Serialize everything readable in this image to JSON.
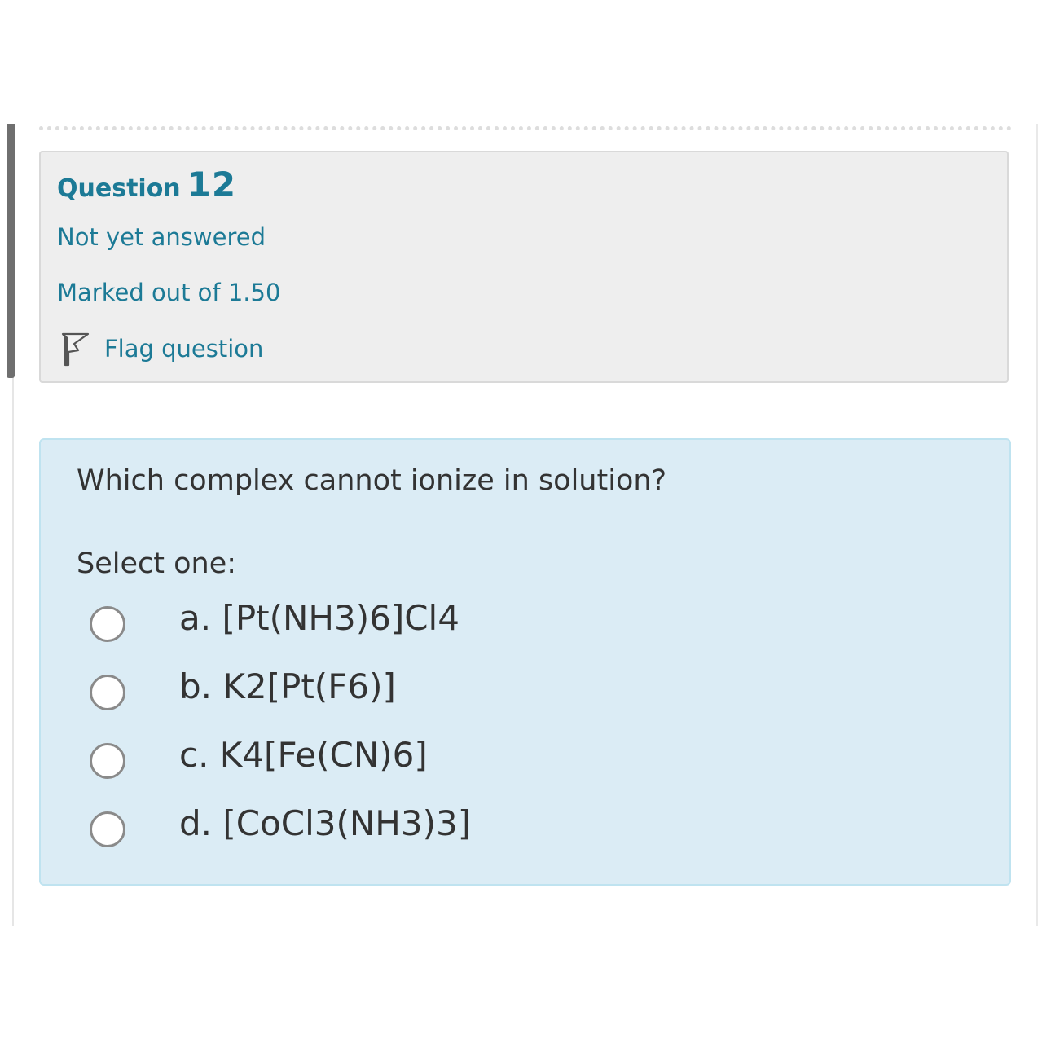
{
  "question_info": {
    "label": "Question",
    "number": "12",
    "status": "Not yet answered",
    "marks": "Marked out of 1.50",
    "flag_label": "Flag question",
    "flag_icon": "flag-icon"
  },
  "formulation": {
    "question_text": "Which complex cannot ionize in solution?",
    "prompt": "Select one:",
    "answers": [
      {
        "label": "a. [Pt(NH3)6]Cl4",
        "selected": false
      },
      {
        "label": "b. K2[Pt(F6)]",
        "selected": false
      },
      {
        "label": "c. K4[Fe(CN)6]",
        "selected": false
      },
      {
        "label": "d. [CoCl3(NH3)3]",
        "selected": false
      }
    ]
  },
  "colors": {
    "accent_text": "#1c7a96",
    "info_background": "#eeeeee",
    "formulation_background": "#dbecf5",
    "body_text": "#333333"
  }
}
